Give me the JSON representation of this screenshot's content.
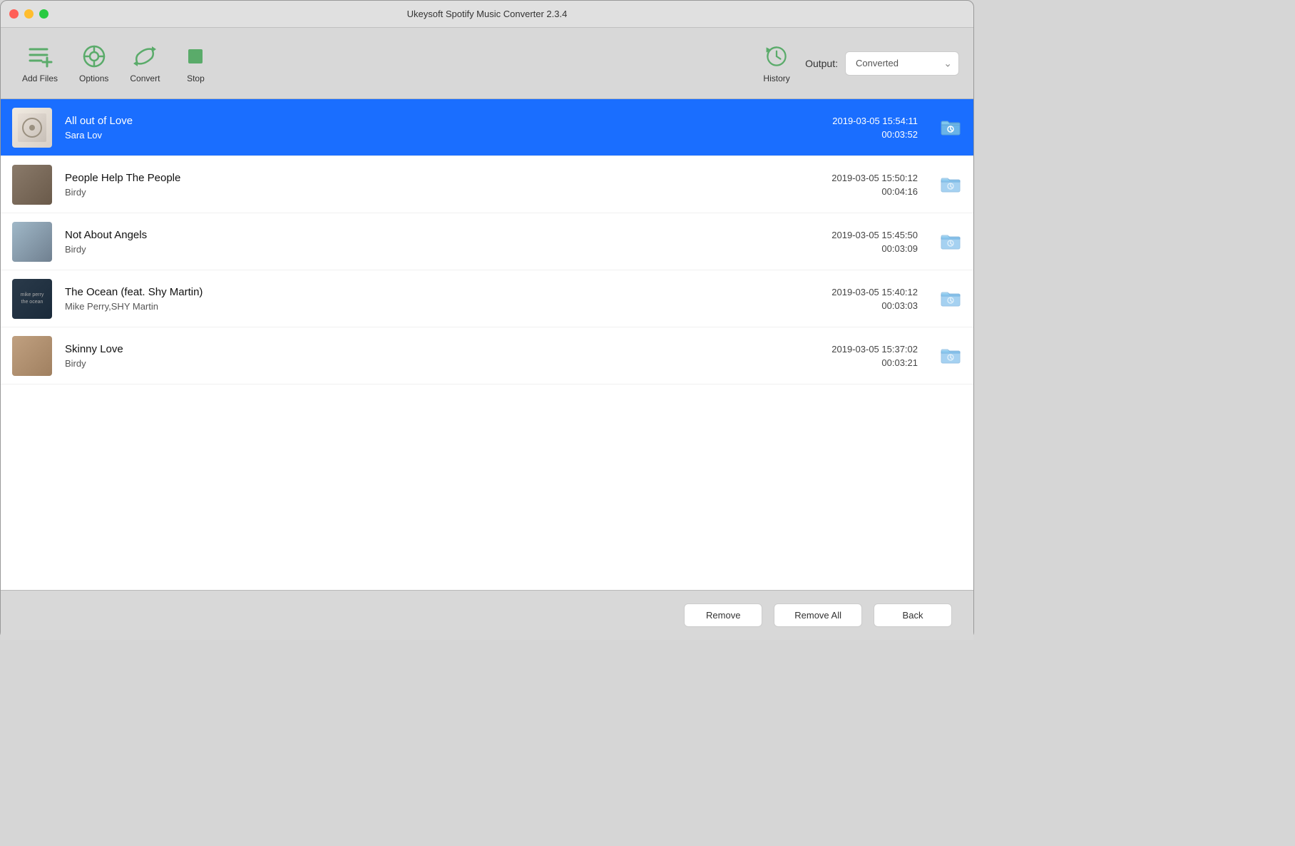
{
  "window": {
    "title": "Ukeysoft Spotify Music Converter 2.3.4"
  },
  "window_controls": {
    "close": "close",
    "minimize": "minimize",
    "maximize": "maximize"
  },
  "toolbar": {
    "add_files_label": "Add Files",
    "options_label": "Options",
    "convert_label": "Convert",
    "stop_label": "Stop",
    "history_label": "History",
    "output_label": "Output:",
    "output_value": "Converted"
  },
  "tracks": [
    {
      "title": "All out of Love",
      "artist": "Sara Lov",
      "date": "2019-03-05 15:54:11",
      "duration": "00:03:52",
      "selected": true,
      "art_type": "sara-lov"
    },
    {
      "title": "People Help The People",
      "artist": "Birdy",
      "date": "2019-03-05 15:50:12",
      "duration": "00:04:16",
      "selected": false,
      "art_type": "birdy-1"
    },
    {
      "title": "Not About Angels",
      "artist": "Birdy",
      "date": "2019-03-05 15:45:50",
      "duration": "00:03:09",
      "selected": false,
      "art_type": "birdy-2"
    },
    {
      "title": "The Ocean (feat. Shy Martin)",
      "artist": "Mike Perry,SHY Martin",
      "date": "2019-03-05 15:40:12",
      "duration": "00:03:03",
      "selected": false,
      "art_type": "mike-perry"
    },
    {
      "title": "Skinny Love",
      "artist": "Birdy",
      "date": "2019-03-05 15:37:02",
      "duration": "00:03:21",
      "selected": false,
      "art_type": "skinny-love"
    }
  ],
  "bottom_bar": {
    "remove_label": "Remove",
    "remove_all_label": "Remove All",
    "back_label": "Back"
  }
}
